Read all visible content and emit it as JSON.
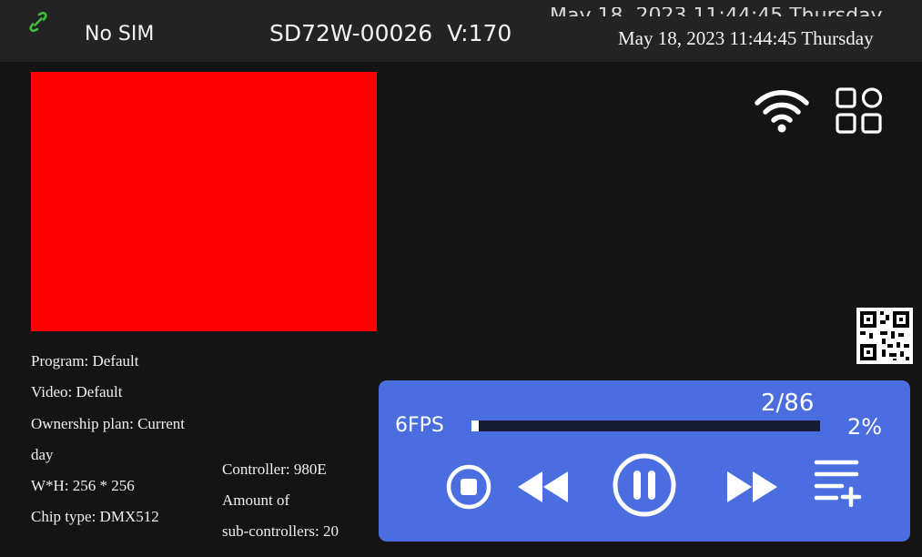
{
  "status_bar": {
    "connection_icon": "link-icon",
    "connection_color": "#3fbf3f",
    "sim_status": "No SIM",
    "device_id": "SD72W-00026",
    "version": "V:170",
    "datetime": "May 18, 2023 11:44:45 Thursday"
  },
  "preview": {
    "color": "#ff0000"
  },
  "icons": {
    "wifi": "wifi-icon",
    "apps": "apps-grid-icon",
    "qr": "qr-code-icon"
  },
  "info": {
    "program": "Program: Default",
    "video": "Video: Default",
    "ownership_line1": "Ownership  plan:  Current",
    "ownership_line2": "day",
    "size": "W*H: 256 * 256",
    "chip": "Chip type: DMX512",
    "controller": "Controller: 980E",
    "amount_line1": "Amount of",
    "amount_line2": "sub-controllers: 20"
  },
  "player": {
    "fps": "6FPS",
    "count": "2/86",
    "percent_label": "2%",
    "progress": 0.02,
    "accent": "#4a6ee0",
    "buttons": [
      "stop-button",
      "rewind-button",
      "pause-button",
      "fast-forward-button",
      "playlist-add-button"
    ]
  }
}
